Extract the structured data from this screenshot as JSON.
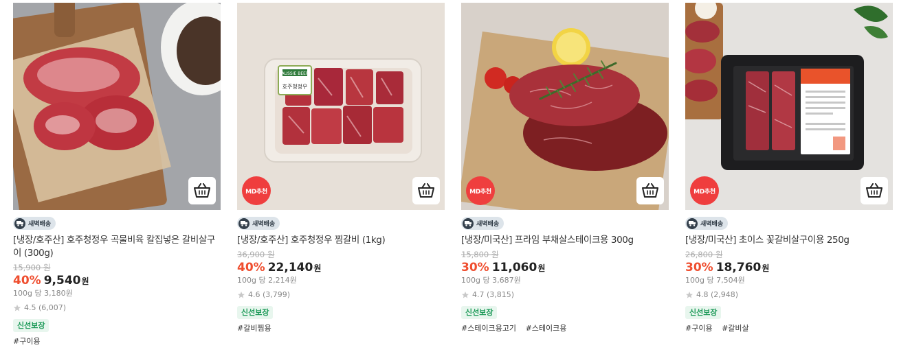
{
  "products": [
    {
      "image_subject": "beef-short-rib-rolls-on-board",
      "md_badge": "",
      "delivery": "새벽배송",
      "title": "[냉장/호주산] 호주청정우 곡물비육 칼집넣은 갈비살구이 (300g)",
      "original_price": "15,900 원",
      "discount": "40%",
      "price": "9,540",
      "price_unit": "원",
      "unit_price": "100g 당 3,180원",
      "rating": "4.5 (6,007)",
      "fresh_badge": "신선보장",
      "tags": [
        "#구이용"
      ]
    },
    {
      "image_subject": "braised-short-rib-chunks-tray",
      "md_badge": "MD추천",
      "delivery": "새벽배송",
      "title": "[냉장/호주산] 호주청정우 찜갈비 (1kg)",
      "original_price": "36,900 원",
      "discount": "40%",
      "price": "22,140",
      "price_unit": "원",
      "unit_price": "100g 당 2,214원",
      "rating": "4.6 (3,799)",
      "fresh_badge": "신선보장",
      "tags": [
        "#갈비찜용"
      ]
    },
    {
      "image_subject": "flat-iron-steak-with-rosemary",
      "md_badge": "MD추천",
      "delivery": "새벽배송",
      "title": "[냉장/미국산] 프라임 부채살스테이크용 300g",
      "original_price": "15,800 원",
      "discount": "30%",
      "price": "11,060",
      "price_unit": "원",
      "unit_price": "100g 당 3,687원",
      "rating": "4.7 (3,815)",
      "fresh_badge": "신선보장",
      "tags": [
        "#스테이크용고기",
        "#스테이크용"
      ]
    },
    {
      "image_subject": "boneless-short-rib-vacuum-pack",
      "md_badge": "MD추천",
      "delivery": "새벽배송",
      "title": "[냉장/미국산] 초이스 꽃갈비살구이용 250g",
      "original_price": "26,800 원",
      "discount": "30%",
      "price": "18,760",
      "price_unit": "원",
      "unit_price": "100g 당 7,504원",
      "rating": "4.8 (2,948)",
      "fresh_badge": "신선보장",
      "tags": [
        "#구이용",
        "#갈비살"
      ]
    }
  ],
  "image_labels": {
    "aussie_beef_badge": "AUSSIE BEEF",
    "aussie_beef_caption": "호주청정우"
  },
  "colors": {
    "discount": "#ef4e2f",
    "md_badge": "#ef3e3e",
    "fresh_text": "#1f9b5a",
    "fresh_bg": "#e8f6ee"
  },
  "icons": {
    "cart": "cart-icon",
    "star": "star-icon",
    "truck": "truck-icon"
  }
}
